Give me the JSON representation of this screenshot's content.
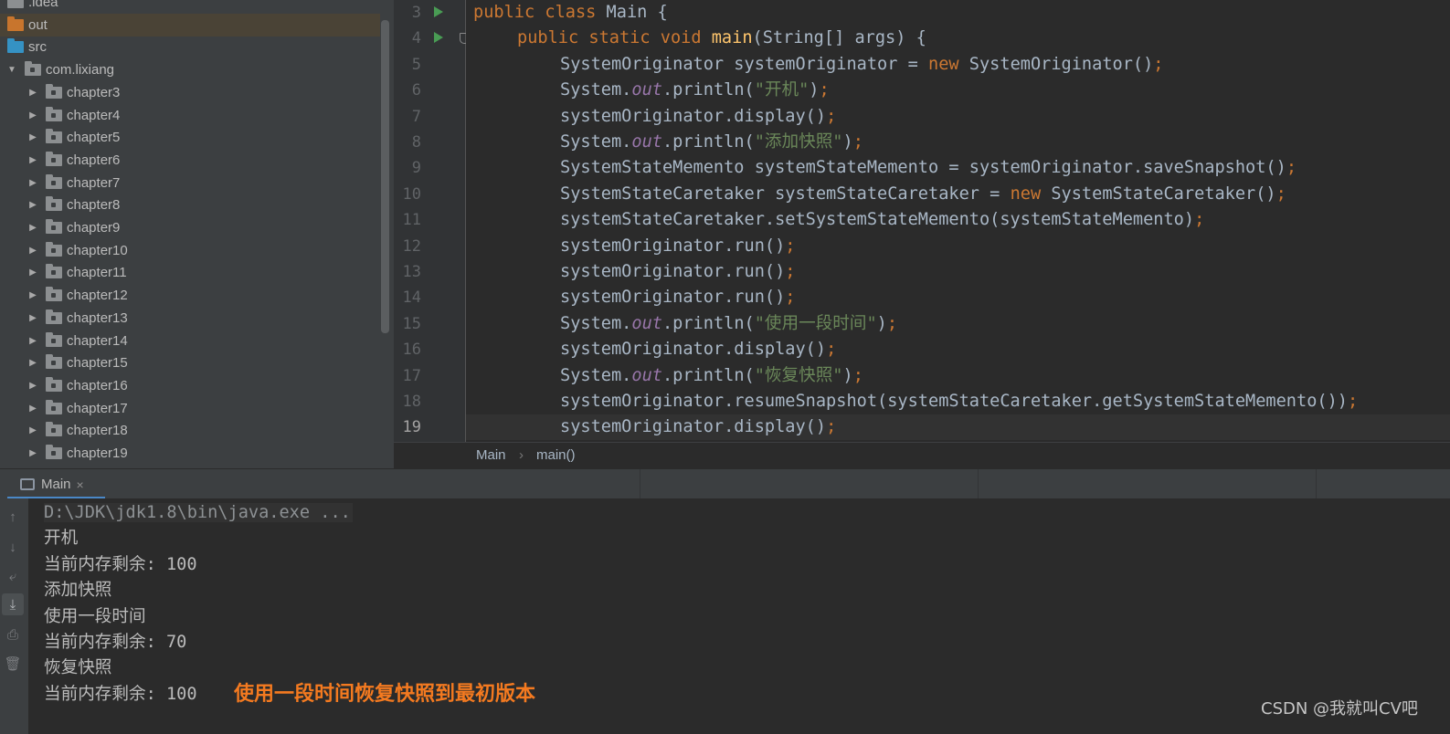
{
  "project_tree": {
    "items": [
      {
        "label": ".idea",
        "icon": "folder-icon"
      },
      {
        "label": "out",
        "icon": "folder-out-icon"
      },
      {
        "label": "src",
        "icon": "folder-src-icon"
      },
      {
        "label": "com.lixiang",
        "icon": "package-icon"
      },
      {
        "label": "chapter3",
        "icon": "package-icon"
      },
      {
        "label": "chapter4",
        "icon": "package-icon"
      },
      {
        "label": "chapter5",
        "icon": "package-icon"
      },
      {
        "label": "chapter6",
        "icon": "package-icon"
      },
      {
        "label": "chapter7",
        "icon": "package-icon"
      },
      {
        "label": "chapter8",
        "icon": "package-icon"
      },
      {
        "label": "chapter9",
        "icon": "package-icon"
      },
      {
        "label": "chapter10",
        "icon": "package-icon"
      },
      {
        "label": "chapter11",
        "icon": "package-icon"
      },
      {
        "label": "chapter12",
        "icon": "package-icon"
      },
      {
        "label": "chapter13",
        "icon": "package-icon"
      },
      {
        "label": "chapter14",
        "icon": "package-icon"
      },
      {
        "label": "chapter15",
        "icon": "package-icon"
      },
      {
        "label": "chapter16",
        "icon": "package-icon"
      },
      {
        "label": "chapter17",
        "icon": "package-icon"
      },
      {
        "label": "chapter18",
        "icon": "package-icon"
      },
      {
        "label": "chapter19",
        "icon": "package-icon"
      }
    ],
    "expand_arrow": "▶",
    "collapse_arrow": "▼"
  },
  "editor": {
    "line_numbers": [
      "3",
      "4",
      "5",
      "6",
      "7",
      "8",
      "9",
      "10",
      "11",
      "12",
      "13",
      "14",
      "15",
      "16",
      "17",
      "18",
      "19"
    ],
    "current_line": "19",
    "code": {
      "kw_public": "public",
      "kw_class": "class",
      "class_name": " Main {",
      "kw_public2": "public",
      "kw_static": "static",
      "kw_void": "void",
      "main_fn": "main",
      "main_sig": "(String[] args) {",
      "l5a": "SystemOriginator systemOriginator = ",
      "l5new": "new",
      "l5b": " SystemOriginator()",
      "semi": ";",
      "sys": "System.",
      "out": "out",
      "println": ".println(",
      "s1": "\"开机\"",
      "s2": "\"添加快照\"",
      "s3": "\"使用一段时间\"",
      "s4": "\"恢复快照\"",
      "close": ")",
      "l7": "systemOriginator.display()",
      "l9": "SystemStateMemento systemStateMemento = systemOriginator.saveSnapshot()",
      "l10a": "SystemStateCaretaker systemStateCaretaker = ",
      "l10b": " SystemStateCaretaker()",
      "l11": "systemStateCaretaker.setSystemStateMemento(systemStateMemento)",
      "l12": "systemOriginator.run()",
      "l18": "systemOriginator.resumeSnapshot(systemStateCaretaker.getSystemStateMemento())"
    }
  },
  "breadcrumb": {
    "class": "Main",
    "separator": "›",
    "method": "main()"
  },
  "run_window": {
    "tab_label": "Main",
    "tab_close": "×",
    "toolbar": [
      "up-arrow-icon",
      "down-arrow-icon",
      "soft-wrap-icon",
      "scroll-to-end-icon",
      "print-icon",
      "trash-icon"
    ],
    "console_lines": [
      "D:\\JDK\\jdk1.8\\bin\\java.exe ...",
      "开机",
      "当前内存剩余: 100",
      "添加快照",
      "使用一段时间",
      "当前内存剩余: 70",
      "恢复快照",
      "当前内存剩余: 100"
    ],
    "annotation": "使用一段时间恢复快照到最初版本"
  },
  "watermark": "CSDN @我就叫CV吧",
  "colors": {
    "keyword": "#cc7832",
    "function": "#ffc66d",
    "field": "#9876aa",
    "string": "#6a8759",
    "annotation": "#f47a20"
  }
}
